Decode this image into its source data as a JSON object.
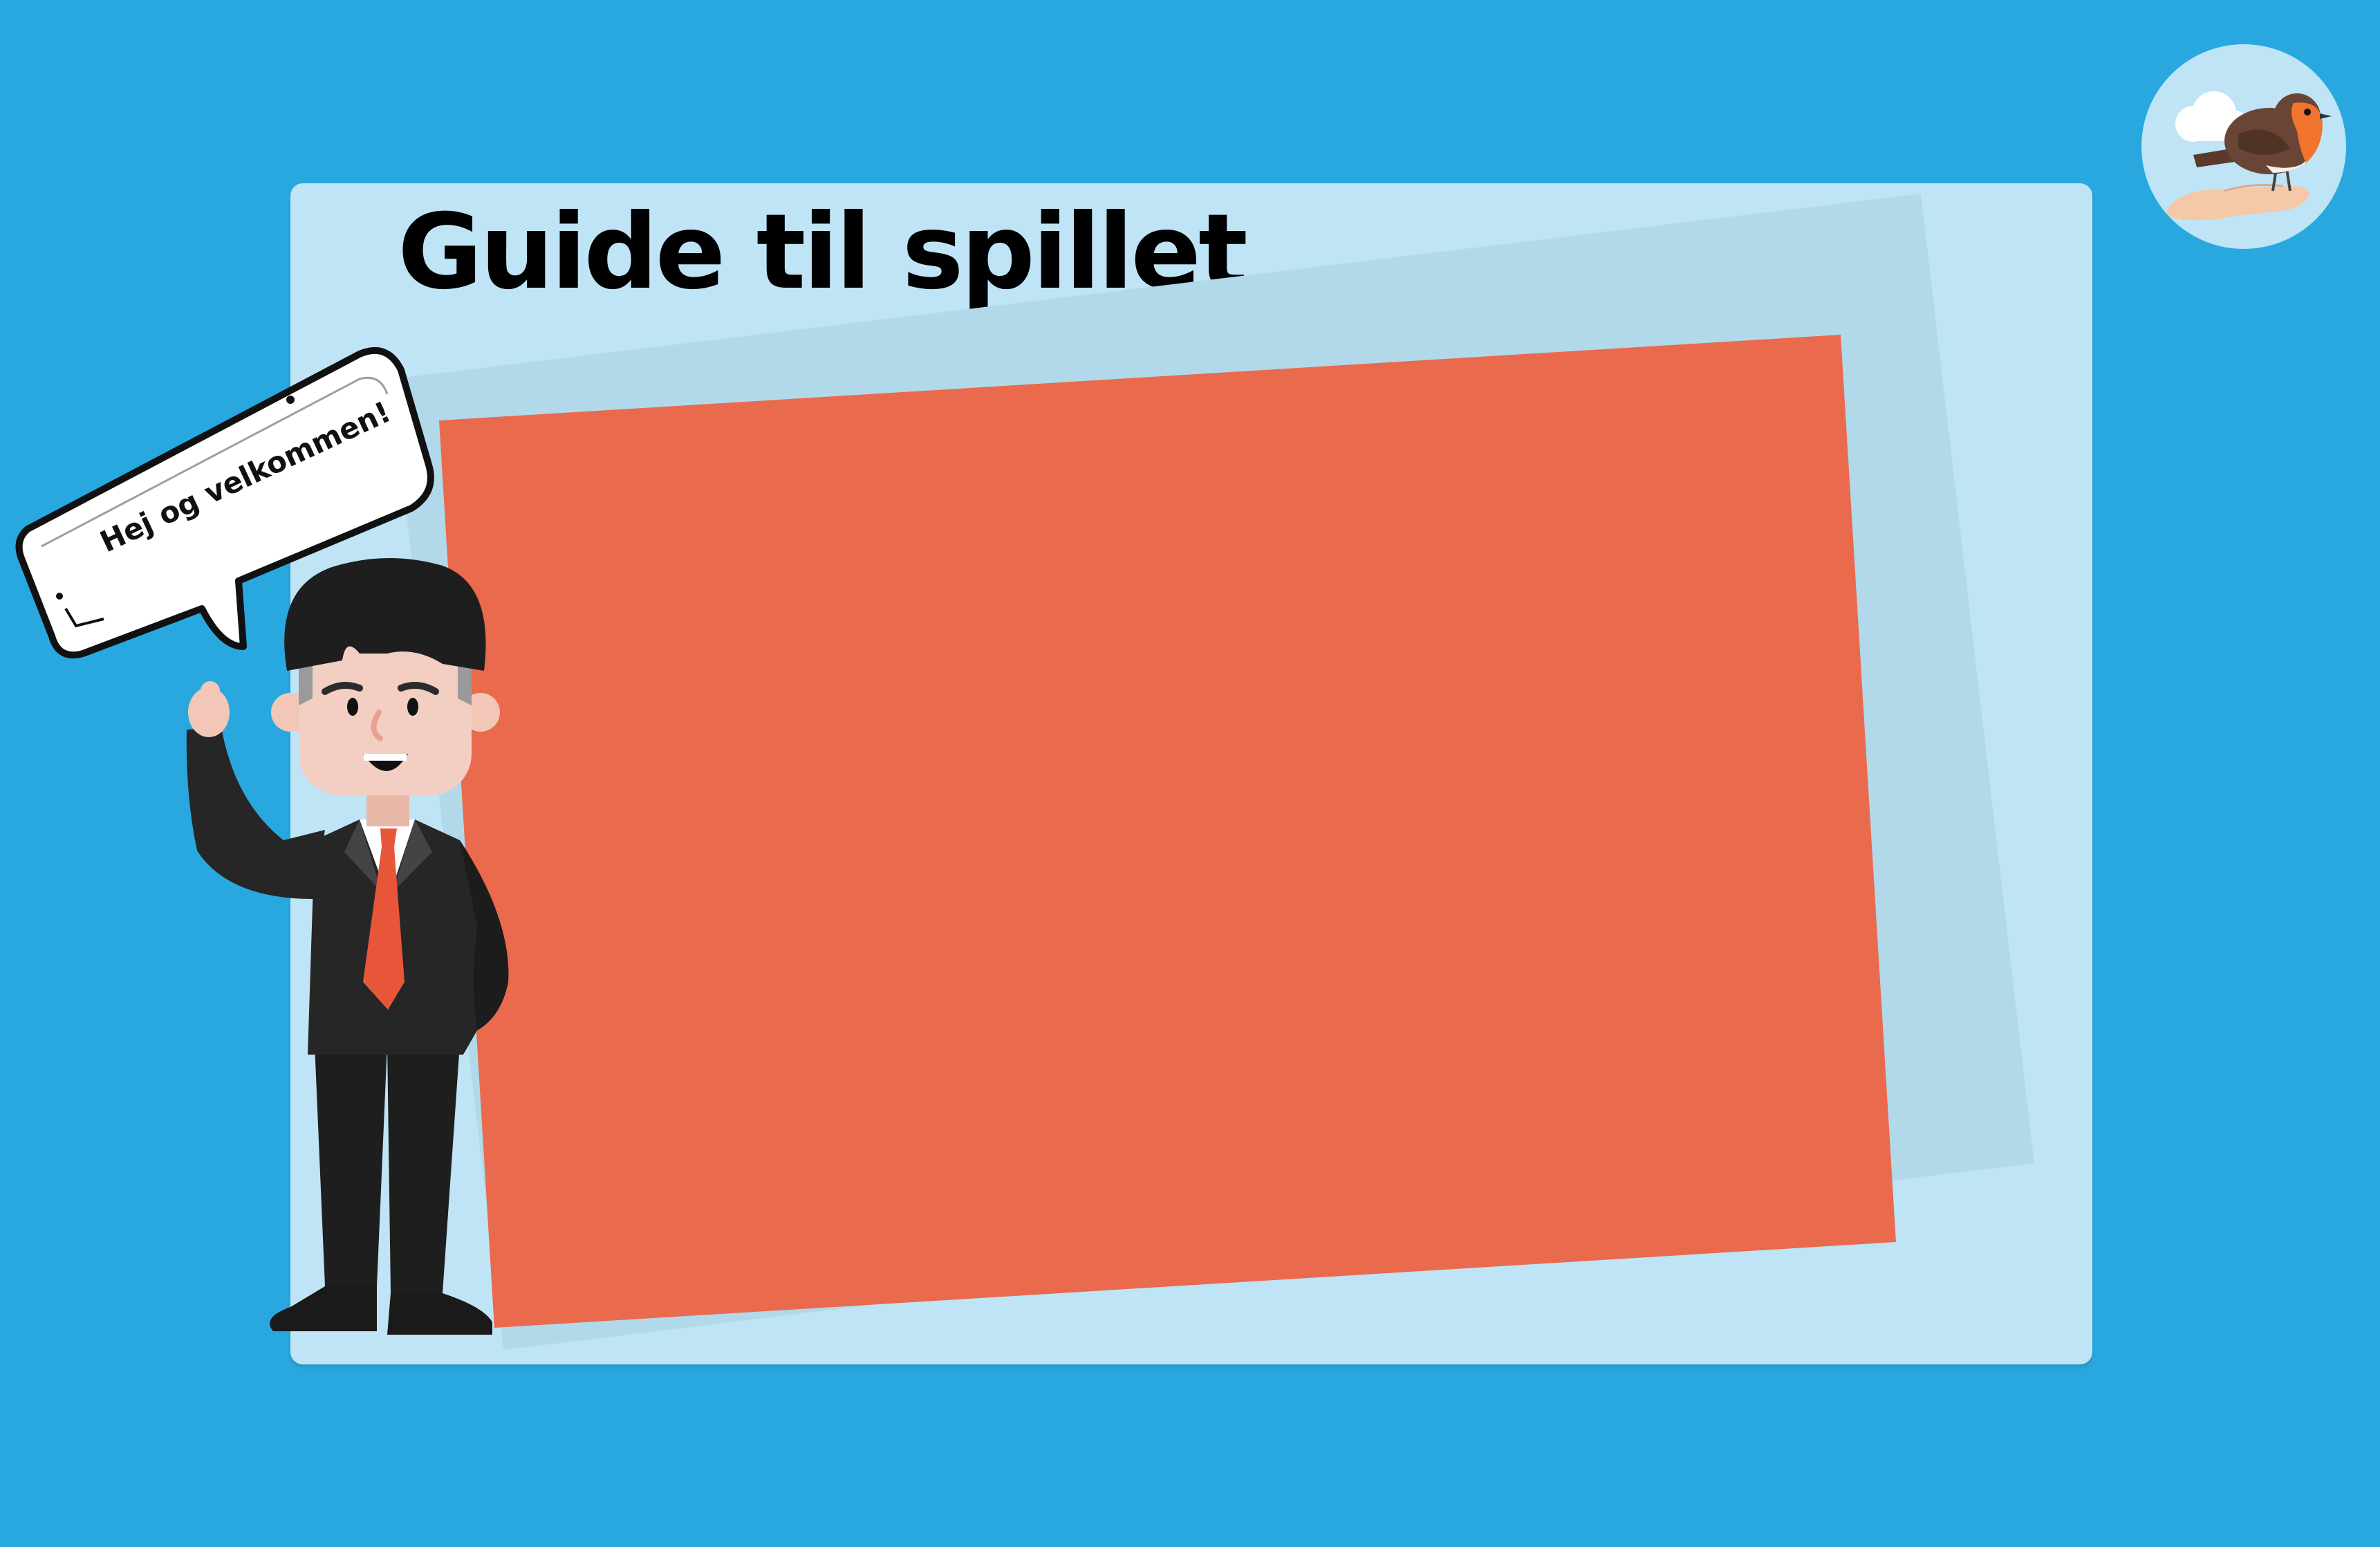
{
  "game": {
    "title": "Guide til spillet",
    "speech_bubble": "Hej og velkommen!"
  },
  "colors": {
    "background": "#29a8e0",
    "panel": "#bfe4f5",
    "back_card": "#b2d9ea",
    "content_card": "#e96a4d",
    "tie": "#e8563a"
  },
  "icons": {
    "logo": "robin-bird-on-hand-icon",
    "character": "waving-businessman"
  }
}
